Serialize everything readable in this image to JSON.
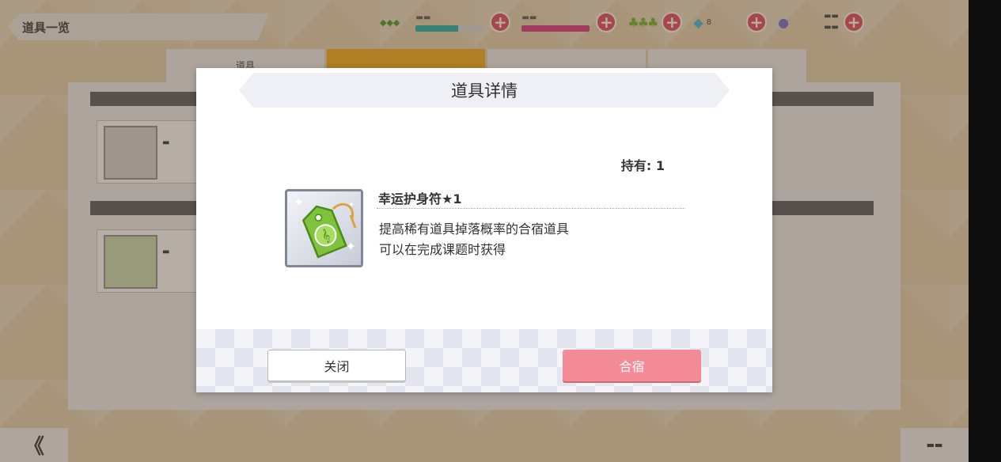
{
  "background": {
    "screen_title": "道具一览",
    "tabs": [
      "道具",
      "",
      "",
      ""
    ],
    "active_tab_index": 1,
    "bottom_left_glyph": "《",
    "topbar": {
      "gem_count": "8"
    }
  },
  "dialog": {
    "title": "道具详情",
    "owned": "持有: 1",
    "item": {
      "name": "幸运护身符★1",
      "description_line1": "提高稀有道具掉落概率的合宿道具",
      "description_line2": "可以在完成课题时获得",
      "icon": "green-charm-tag-icon"
    },
    "buttons": {
      "close": "关闭",
      "camp": "合宿"
    }
  },
  "colors": {
    "accent_pink": "#f48c98",
    "tab_orange": "#f5b330",
    "item_green": "#7fc23d"
  }
}
